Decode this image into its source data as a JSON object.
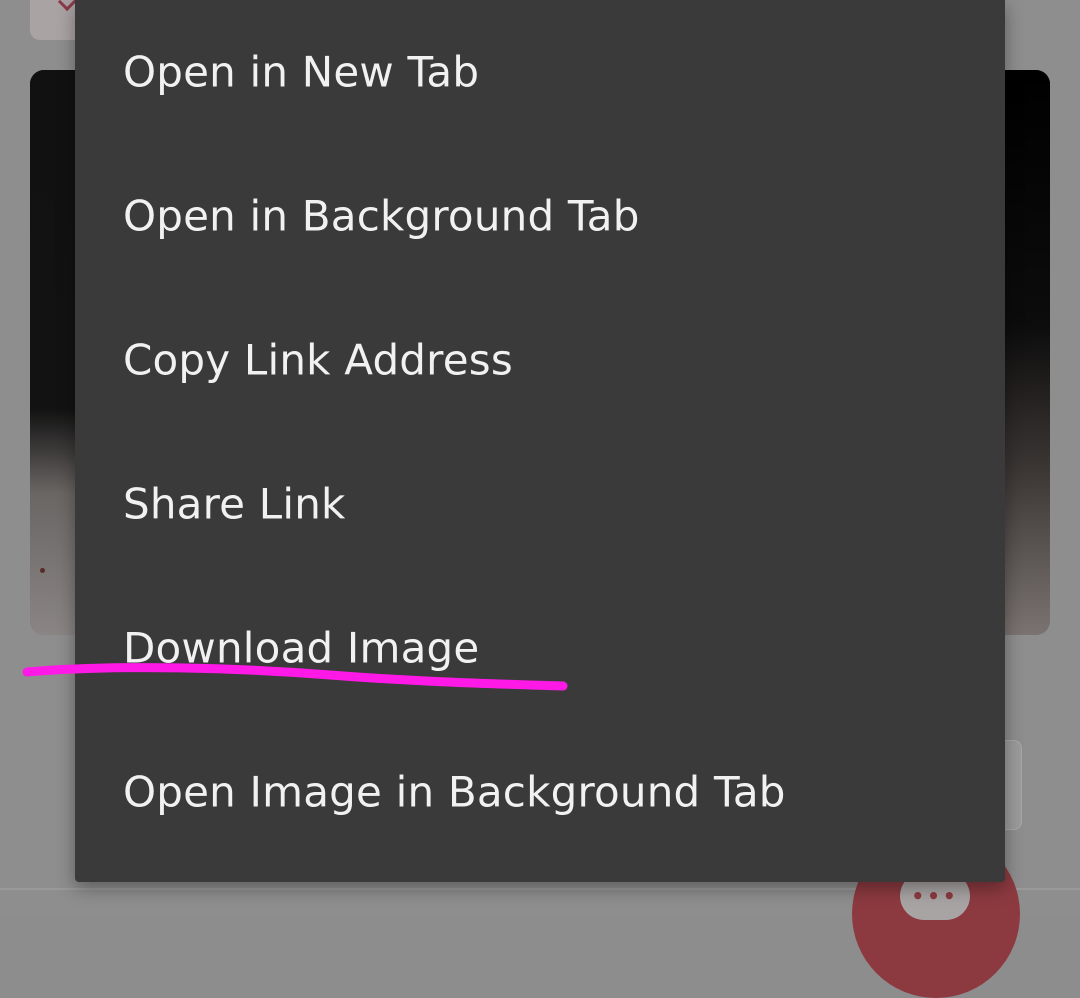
{
  "context_menu": {
    "items": [
      {
        "label": "Open in New Tab"
      },
      {
        "label": "Open in Background Tab"
      },
      {
        "label": "Copy Link Address"
      },
      {
        "label": "Share Link"
      },
      {
        "label": "Download Image"
      },
      {
        "label": "Open Image in Background Tab"
      }
    ]
  },
  "annotation": {
    "type": "underline",
    "target": "Download Image",
    "color": "#ff19e6"
  },
  "fab": {
    "icon": "chat-bubble-icon",
    "icon_text": "•••"
  },
  "colors": {
    "menu_background": "#3a3a3a",
    "menu_text": "#f1f1f1",
    "scrim": "#8e8e8e",
    "fab_background": "#8c3a40"
  }
}
